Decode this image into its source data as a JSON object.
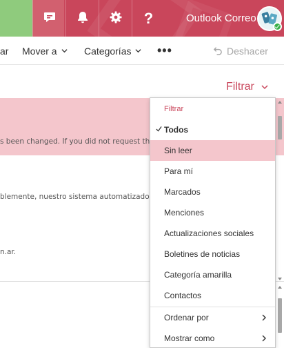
{
  "topbar": {
    "brand": "Outlook Correo",
    "icons": [
      "chat-icon",
      "bell-icon",
      "gear-icon",
      "help-icon"
    ],
    "help_glyph": "?",
    "colors": {
      "bar": "#c9465b",
      "green_tile": "#8fcb7d",
      "presence": "#3ab04a"
    }
  },
  "commandbar": {
    "truncated_label": "ar",
    "move_to": "Mover a",
    "categories": "Categorías",
    "more": "•••",
    "undo": "Deshacer"
  },
  "filter": {
    "label": "Filtrar",
    "menu": {
      "title": "Filtrar",
      "items": [
        {
          "label": "Todos",
          "checked": true
        },
        {
          "label": "Sin leer",
          "highlighted": true
        },
        {
          "label": "Para mí"
        },
        {
          "label": "Marcados"
        },
        {
          "label": "Menciones"
        },
        {
          "label": "Actualizaciones sociales"
        },
        {
          "label": "Boletines de noticias"
        },
        {
          "label": "Categoría amarilla"
        },
        {
          "label": "Contactos"
        }
      ],
      "submenus": [
        {
          "label": "Ordenar por"
        },
        {
          "label": "Mostrar como"
        }
      ]
    }
  },
  "messages": [
    {
      "snippet": "s been changed. If you did not request this",
      "selected": true
    },
    {
      "snippet": "blemente, nuestro sistema automatizado ha"
    },
    {
      "snippet": "n.ar."
    }
  ],
  "accent": "#c9465b",
  "highlight": "#f4c6cc"
}
